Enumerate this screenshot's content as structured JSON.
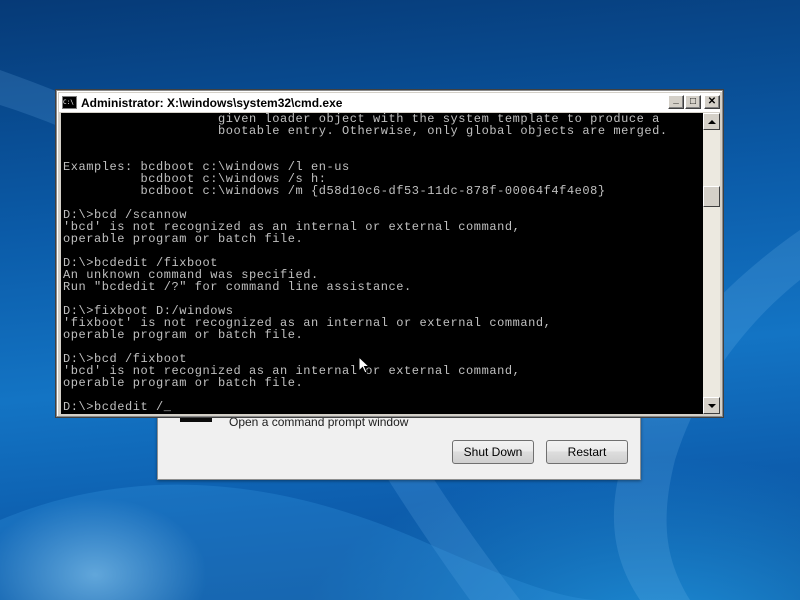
{
  "desktop": {
    "wallpaper": "windows-7-harmony"
  },
  "recovery_dialog": {
    "option_text": "Open a command prompt window",
    "shutdown_label": "Shut Down",
    "restart_label": "Restart"
  },
  "cmd_window": {
    "title": "Administrator: X:\\windows\\system32\\cmd.exe",
    "icon_text": "C:\\",
    "controls": {
      "minimize": "_",
      "maximize": "□",
      "close": "✕"
    },
    "text_color": "#c0c0c0",
    "background_color": "#000000",
    "lines": [
      "                    given loader object with the system template to produce a",
      "                    bootable entry. Otherwise, only global objects are merged.",
      "",
      "",
      "Examples: bcdboot c:\\windows /l en-us",
      "          bcdboot c:\\windows /s h:",
      "          bcdboot c:\\windows /m {d58d10c6-df53-11dc-878f-00064f4f4e08}",
      "",
      "D:\\>bcd /scannow",
      "'bcd' is not recognized as an internal or external command,",
      "operable program or batch file.",
      "",
      "D:\\>bcdedit /fixboot",
      "An unknown command was specified.",
      "Run \"bcdedit /?\" for command line assistance.",
      "",
      "D:\\>fixboot D:/windows",
      "'fixboot' is not recognized as an internal or external command,",
      "operable program or batch file.",
      "",
      "D:\\>bcd /fixboot",
      "'bcd' is not recognized as an internal or external command,",
      "operable program or batch file.",
      "",
      "D:\\>bcdedit /_"
    ]
  }
}
